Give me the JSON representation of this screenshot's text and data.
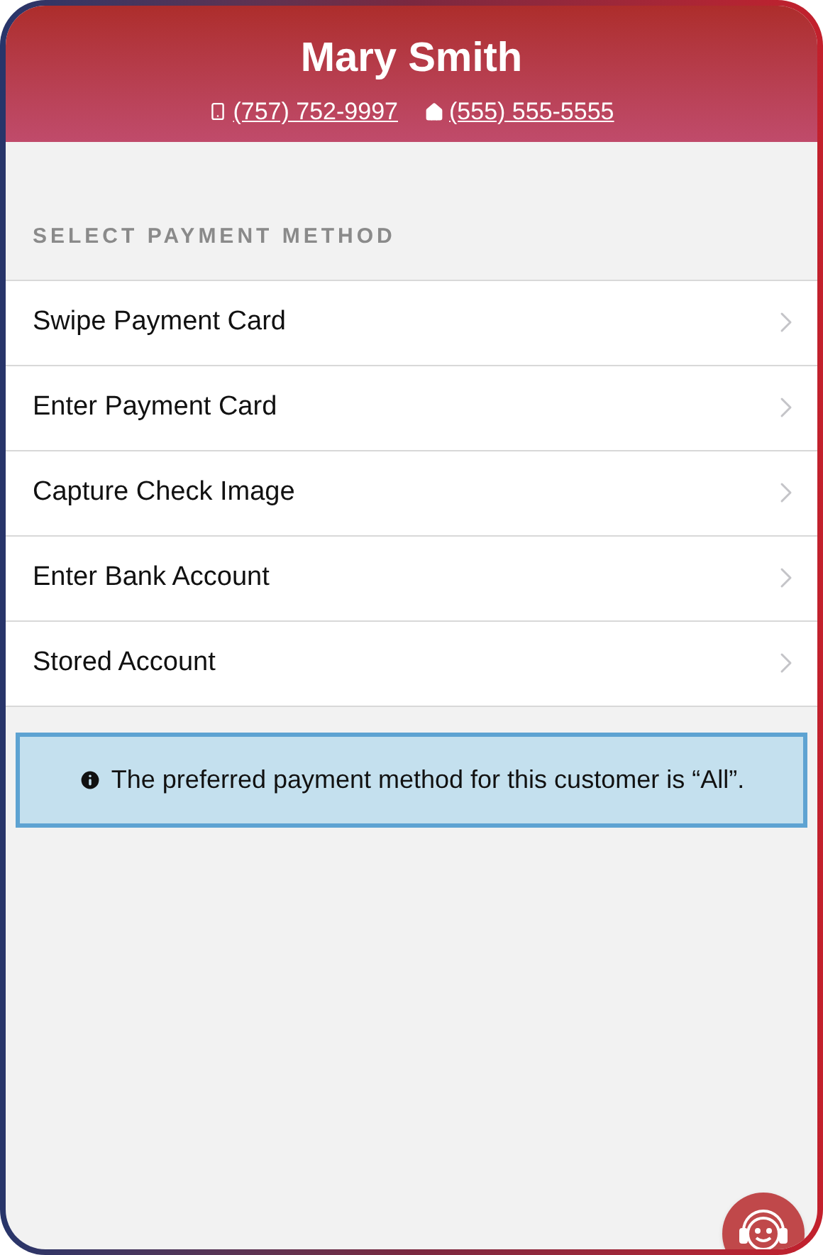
{
  "header": {
    "name": "Mary Smith",
    "phones": [
      {
        "kind": "mobile",
        "number": "(757) 752-9997"
      },
      {
        "kind": "home",
        "number": "(555) 555-5555"
      }
    ]
  },
  "section_title": "SELECT PAYMENT METHOD",
  "payment_methods": [
    {
      "label": "Swipe Payment Card"
    },
    {
      "label": "Enter Payment Card"
    },
    {
      "label": "Capture Check Image"
    },
    {
      "label": "Enter Bank Account"
    },
    {
      "label": "Stored Account"
    }
  ],
  "info_message": "The preferred payment method for this customer is “All”."
}
